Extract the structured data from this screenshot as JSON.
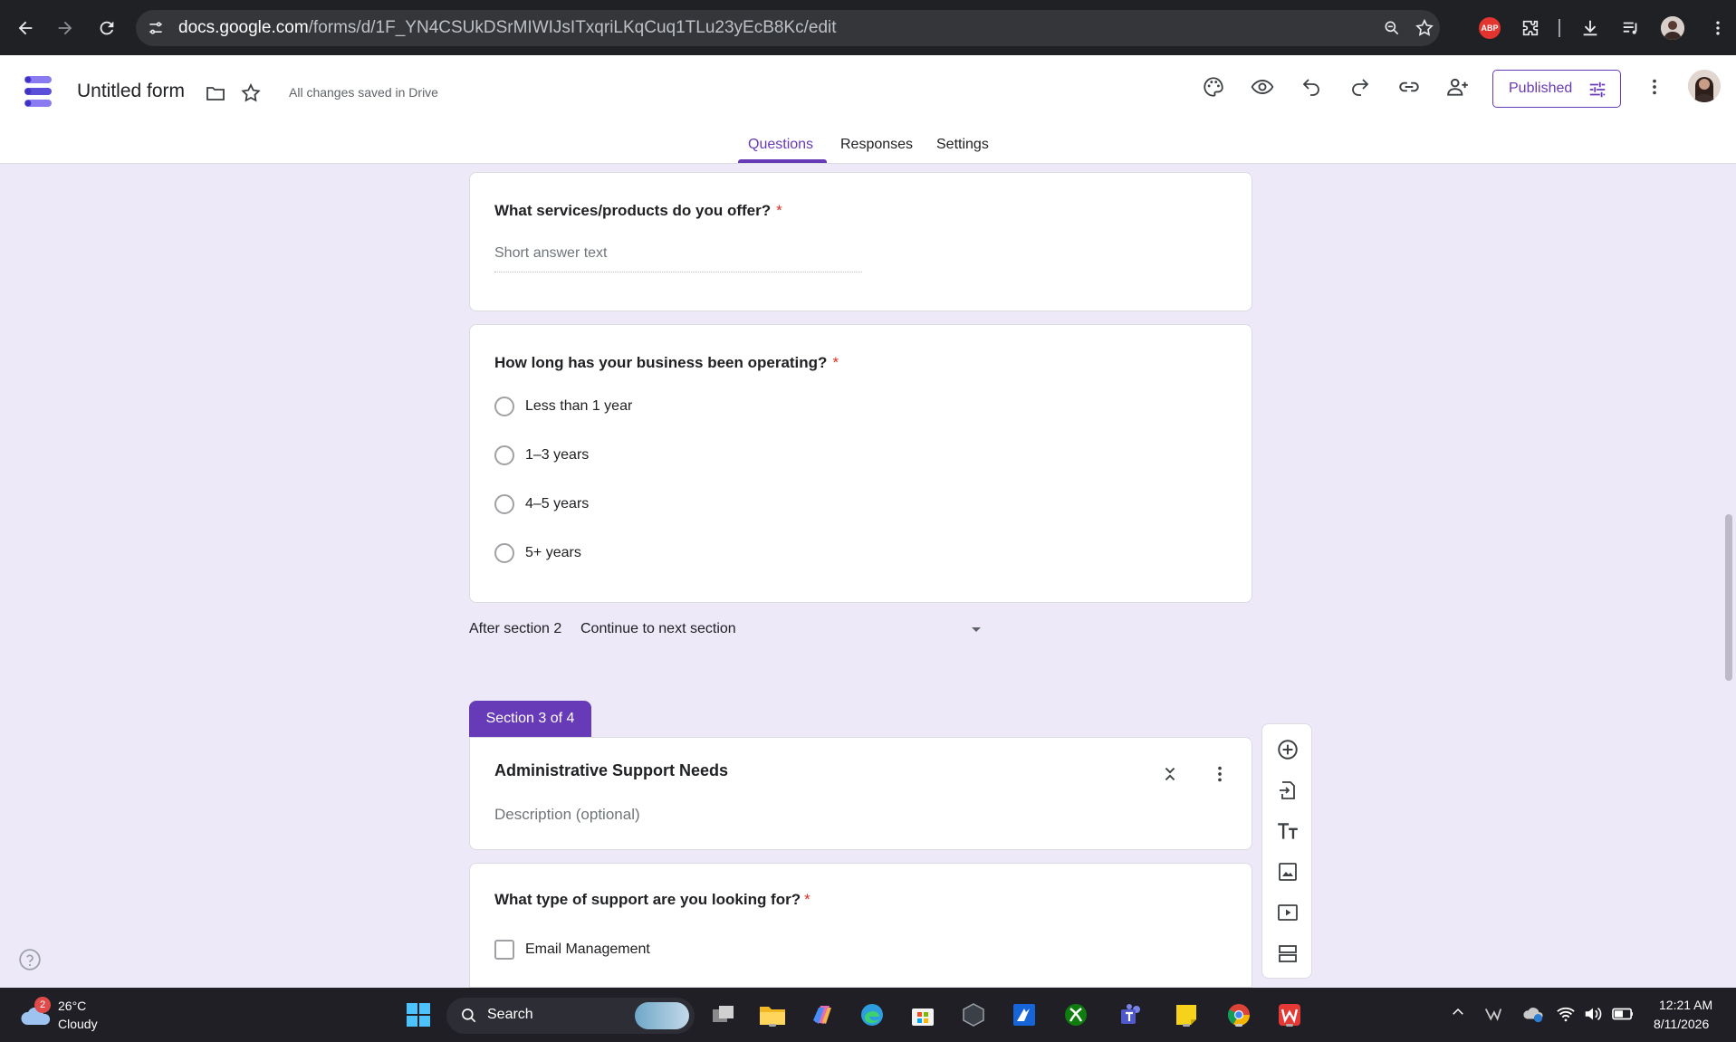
{
  "browser": {
    "url_host": "docs.google.com",
    "url_path": "/forms/d/1F_YN4CSUkDSrMIWIJsITxqriLKqCuq1TLu23yEcB8Kc/edit",
    "abp_label": "ABP"
  },
  "header": {
    "title": "Untitled form",
    "saved_status": "All changes saved in Drive",
    "published_label": "Published"
  },
  "tabs": [
    {
      "label": "Questions",
      "active": true
    },
    {
      "label": "Responses",
      "active": false
    },
    {
      "label": "Settings",
      "active": false
    }
  ],
  "questions": {
    "q1": {
      "title": "What services/products do you offer?",
      "required_mark": "*",
      "placeholder": "Short answer text"
    },
    "q2": {
      "title": "How long has your business been operating?",
      "required_mark": "*",
      "options": [
        "Less than 1 year",
        "1–3 years",
        "4–5 years",
        "5+ years"
      ]
    }
  },
  "after_section": {
    "label": "After section 2",
    "value": "Continue to next section"
  },
  "section3": {
    "tab_label": "Section 3 of 4",
    "title": "Administrative Support Needs",
    "description_placeholder": "Description (optional)"
  },
  "q3": {
    "title": "What type of support are you looking for?",
    "required_mark": "*",
    "options": [
      "Email Management"
    ]
  },
  "taskbar": {
    "weather_temp": "26°C",
    "weather_cond": "Cloudy",
    "weather_badge": "2",
    "search_label": "Search",
    "time": "12:21 AM",
    "date": "8/11/2026"
  },
  "colors": {
    "accent": "#673ab7",
    "background": "#ede9f9",
    "required": "#d93025"
  }
}
